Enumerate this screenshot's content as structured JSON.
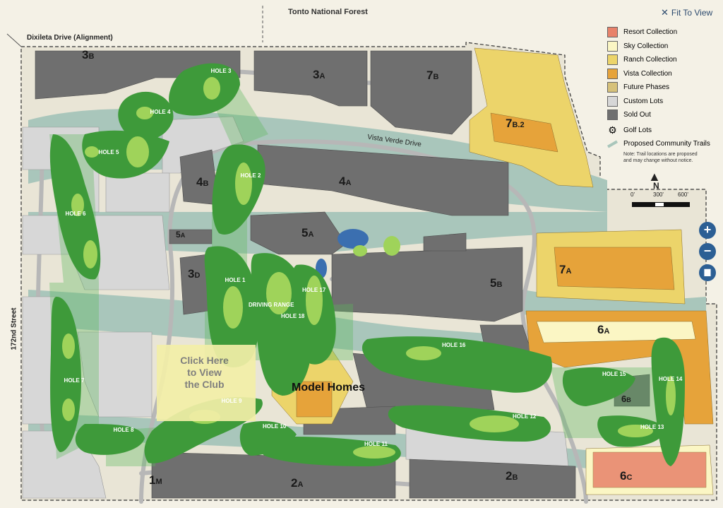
{
  "header": {
    "forest_label": "Tonto National Forest",
    "fit_to_view": "Fit To View"
  },
  "streets": {
    "dixileta": "Dixileta Drive (Alignment)",
    "vista_verde": "Vista Verde Drive",
    "street_172": "172nd Street"
  },
  "legend": {
    "items": [
      {
        "label": "Resort Collection",
        "color": "#e8826a"
      },
      {
        "label": "Sky Collection",
        "color": "#fbf6c4"
      },
      {
        "label": "Ranch Collection",
        "color": "#ecd46a"
      },
      {
        "label": "Vista Collection",
        "color": "#e6a33a"
      },
      {
        "label": "Future Phases",
        "color": "#d6c17a"
      },
      {
        "label": "Custom Lots",
        "color": "#d7d7d7"
      },
      {
        "label": "Sold Out",
        "color": "#6f6f6f"
      }
    ],
    "golf_lots": "Golf Lots",
    "trails": "Proposed Community Trails",
    "trail_note_1": "Note: Trail locations are proposed",
    "trail_note_2": "and may change without notice."
  },
  "scale": {
    "north": "N",
    "ticks": [
      "0'",
      "300'",
      "600'"
    ]
  },
  "zoom_controls": {
    "zoom_in": "+",
    "zoom_out": "−",
    "print": "print-icon"
  },
  "phases": {
    "p3b": {
      "num": "3",
      "sub": "B"
    },
    "p3a": {
      "num": "3",
      "sub": "A"
    },
    "p7b": {
      "num": "7",
      "sub": "B"
    },
    "p7b2": {
      "num": "7",
      "sub": "B.2"
    },
    "p4b": {
      "num": "4",
      "sub": "B"
    },
    "p4a": {
      "num": "4",
      "sub": "A"
    },
    "p5a_small": {
      "num": "5",
      "sub": "A"
    },
    "p5a": {
      "num": "5",
      "sub": "A"
    },
    "p3d": {
      "num": "3",
      "sub": "D"
    },
    "p5b": {
      "num": "5",
      "sub": "B"
    },
    "p7a": {
      "num": "7",
      "sub": "A"
    },
    "p6a": {
      "num": "6",
      "sub": "A"
    },
    "p6b": {
      "num": "6",
      "sub": "B"
    },
    "p6c": {
      "num": "6",
      "sub": "C"
    },
    "p2a": {
      "num": "2",
      "sub": "A"
    },
    "p2b": {
      "num": "2",
      "sub": "B"
    },
    "p1m": {
      "num": "1",
      "sub": "M"
    }
  },
  "holes": {
    "h1": "HOLE 1",
    "h2": "HOLE 2",
    "h3": "HOLE 3",
    "h4": "HOLE 4",
    "h5": "HOLE 5",
    "h6": "HOLE 6",
    "h7": "HOLE 7",
    "h8": "HOLE 8",
    "h9": "HOLE 9",
    "h10": "HOLE 10",
    "h11": "HOLE 11",
    "h12": "HOLE 12",
    "h13": "HOLE 13",
    "h14": "HOLE 14",
    "h15": "HOLE 15",
    "h16": "HOLE 16",
    "h17": "HOLE 17",
    "h18": "HOLE 18",
    "range": "DRIVING RANGE"
  },
  "club": {
    "line1": "Click Here",
    "line2": "to View",
    "line3": "the Club"
  },
  "model_homes": "Model Homes",
  "colors": {
    "background": "#f4f1e6",
    "wash": "#a9c6bb",
    "fairway": "#3e9a3a",
    "green": "#9fd35a",
    "road": "#b7b7b7",
    "sold": "#6f6f6f",
    "custom": "#d7d7d7",
    "water": "#3b6fb0",
    "accent_blue": "#2c5f94"
  }
}
